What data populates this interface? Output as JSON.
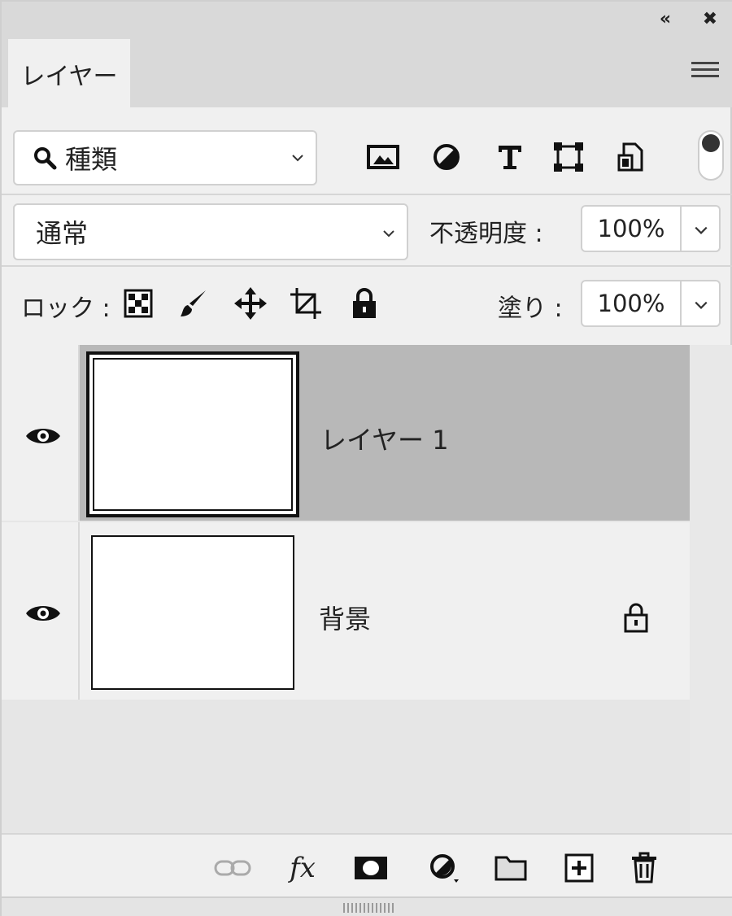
{
  "window": {
    "collapse_glyph": "«",
    "close_glyph": "✖"
  },
  "tab": {
    "label": "レイヤー"
  },
  "filter": {
    "kind_label": "種類",
    "icons": [
      "image-filter-icon",
      "adjustment-filter-icon",
      "type-filter-icon",
      "shape-filter-icon",
      "smart-object-filter-icon"
    ]
  },
  "blend": {
    "mode": "通常",
    "opacity_label": "不透明度 :",
    "opacity_value": "100%"
  },
  "lock": {
    "label": "ロック :",
    "icons": [
      "lock-transparent-pixels-icon",
      "lock-image-pixels-icon",
      "lock-position-icon",
      "lock-artboard-icon",
      "lock-all-icon"
    ],
    "fill_label": "塗り :",
    "fill_value": "100%"
  },
  "layers": [
    {
      "name": "レイヤー 1",
      "visible": true,
      "selected": true,
      "locked": false
    },
    {
      "name": "背景",
      "visible": true,
      "selected": false,
      "locked": true
    }
  ],
  "bottom_icons": [
    "link-layers-icon",
    "fx-icon",
    "add-mask-icon",
    "new-fill-adjustment-icon",
    "new-group-icon",
    "new-layer-icon",
    "delete-layer-icon"
  ],
  "fx_label": "fx"
}
